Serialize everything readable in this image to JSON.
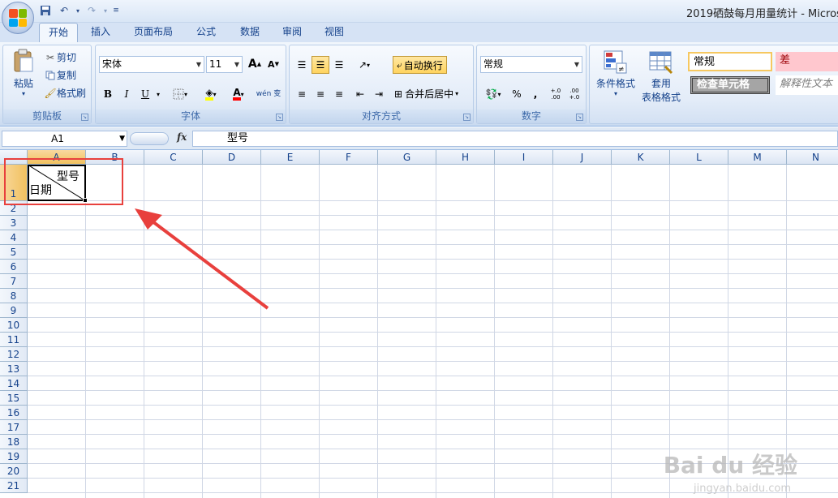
{
  "app": {
    "title": "2019硒鼓每月用量统计 - Microso"
  },
  "tabs": [
    {
      "label": "开始",
      "active": true
    },
    {
      "label": "插入"
    },
    {
      "label": "页面布局"
    },
    {
      "label": "公式"
    },
    {
      "label": "数据"
    },
    {
      "label": "审阅"
    },
    {
      "label": "视图"
    }
  ],
  "ribbon": {
    "clipboard": {
      "paste": "粘贴",
      "cut": "剪切",
      "copy": "复制",
      "format_painter": "格式刷",
      "label": "剪贴板"
    },
    "font": {
      "name": "宋体",
      "size": "11",
      "grow": "A",
      "shrink": "A",
      "bold": "B",
      "italic": "I",
      "underline": "U",
      "font_color_glyph": "A",
      "phonetic": "wén 变",
      "label": "字体"
    },
    "alignment": {
      "wrap_text": "自动换行",
      "merge_center": "合并后居中",
      "label": "对齐方式"
    },
    "number": {
      "format": "常规",
      "percent": "%",
      "comma": ",",
      "inc_decimal": "+.0 .00",
      "dec_decimal": ".00 +.0",
      "label": "数字"
    },
    "styles": {
      "conditional_format": "条件格式",
      "table_format_1": "套用",
      "table_format_2": "表格格式",
      "normal": "常规",
      "bad": "差",
      "check_cell": "检查单元格",
      "explanatory": "解释性文本"
    }
  },
  "formula_bar": {
    "name_box": "A1",
    "fx": "fx",
    "content": "型号"
  },
  "columns": [
    "A",
    "B",
    "C",
    "D",
    "E",
    "F",
    "G",
    "H",
    "I",
    "J",
    "K",
    "L",
    "M",
    "N"
  ],
  "rows": [
    "1",
    "2",
    "3",
    "4",
    "5",
    "6",
    "7",
    "8",
    "9",
    "10",
    "11",
    "12",
    "13",
    "14",
    "15",
    "16",
    "17",
    "18",
    "19",
    "20",
    "21"
  ],
  "cell_a1": {
    "top_right": "型号",
    "bottom_left": "日期"
  },
  "watermark": {
    "brand": "Bai du 经验",
    "url": "jingyan.baidu.com"
  },
  "colors": {
    "annotation": "#e8403d",
    "selection_header": "#f1c15f",
    "ribbon_text": "#15428b"
  }
}
